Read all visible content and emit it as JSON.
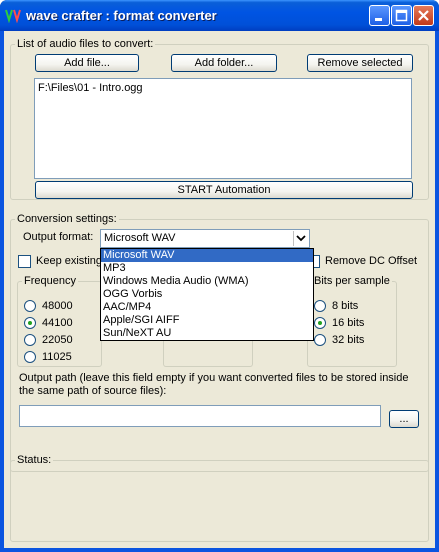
{
  "window": {
    "title": "wave crafter : format converter"
  },
  "files_group": {
    "legend": "List of audio files to convert:",
    "add_file_label": "Add file...",
    "add_folder_label": "Add folder...",
    "remove_selected_label": "Remove selected",
    "files": [
      "F:\\Files\\01 - Intro.ogg"
    ],
    "start_label": "START Automation"
  },
  "conversion": {
    "legend": "Conversion settings:",
    "output_format_label": "Output format:",
    "output_format_value": "Microsoft WAV",
    "format_options": [
      "Microsoft WAV",
      "MP3",
      "Windows Media Audio (WMA)",
      "OGG Vorbis",
      "AAC/MP4",
      "Apple/SGI AIFF",
      "Sun/NeXT AU"
    ],
    "keep_existing_label": "Keep existing",
    "remove_dc_label": "Remove DC Offset",
    "frequency": {
      "legend": "Frequency",
      "options": [
        "48000",
        "44100",
        "22050",
        "11025"
      ],
      "selected": "44100"
    },
    "bits": {
      "legend": "Bits per sample",
      "options": [
        "8 bits",
        "16 bits",
        "32 bits"
      ],
      "selected": "16 bits"
    },
    "output_path_label": "Output path (leave this field empty if you want converted files to be stored inside the same path of source files):",
    "output_path_value": "",
    "browse_label": "..."
  },
  "status": {
    "legend": "Status:"
  }
}
